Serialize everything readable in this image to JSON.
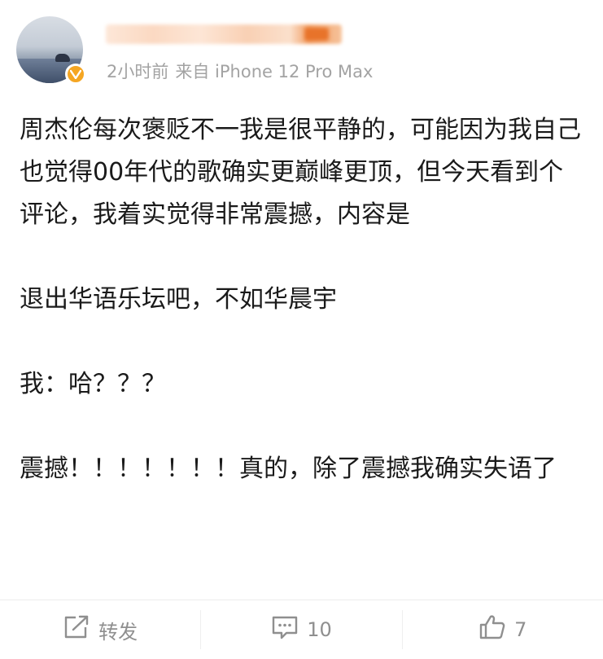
{
  "header": {
    "meta_time": "2小时前",
    "meta_source": "来自 iPhone 12 Pro Max"
  },
  "content": {
    "paragraphs": [
      "周杰伦每次褒贬不一我是很平静的，可能因为我自己也觉得00年代的歌确实更巅峰更顶，但今天看到个评论，我着实觉得非常震撼，内容是",
      "退出华语乐坛吧，不如华晨宇",
      "我：哈？？？",
      "震撼！！！！！！！真的，除了震撼我确实失语了"
    ]
  },
  "footer": {
    "repost_label": "转发",
    "comment_count": "10",
    "like_count": "7"
  },
  "icons": {
    "repost": "share-icon",
    "comment": "comment-icon",
    "like": "thumbs-up-icon",
    "verified": "verified-badge-icon"
  },
  "colors": {
    "verified_badge": "#f5a623",
    "meta_text": "#a3a3a3",
    "action_text": "#8f8f8f"
  }
}
